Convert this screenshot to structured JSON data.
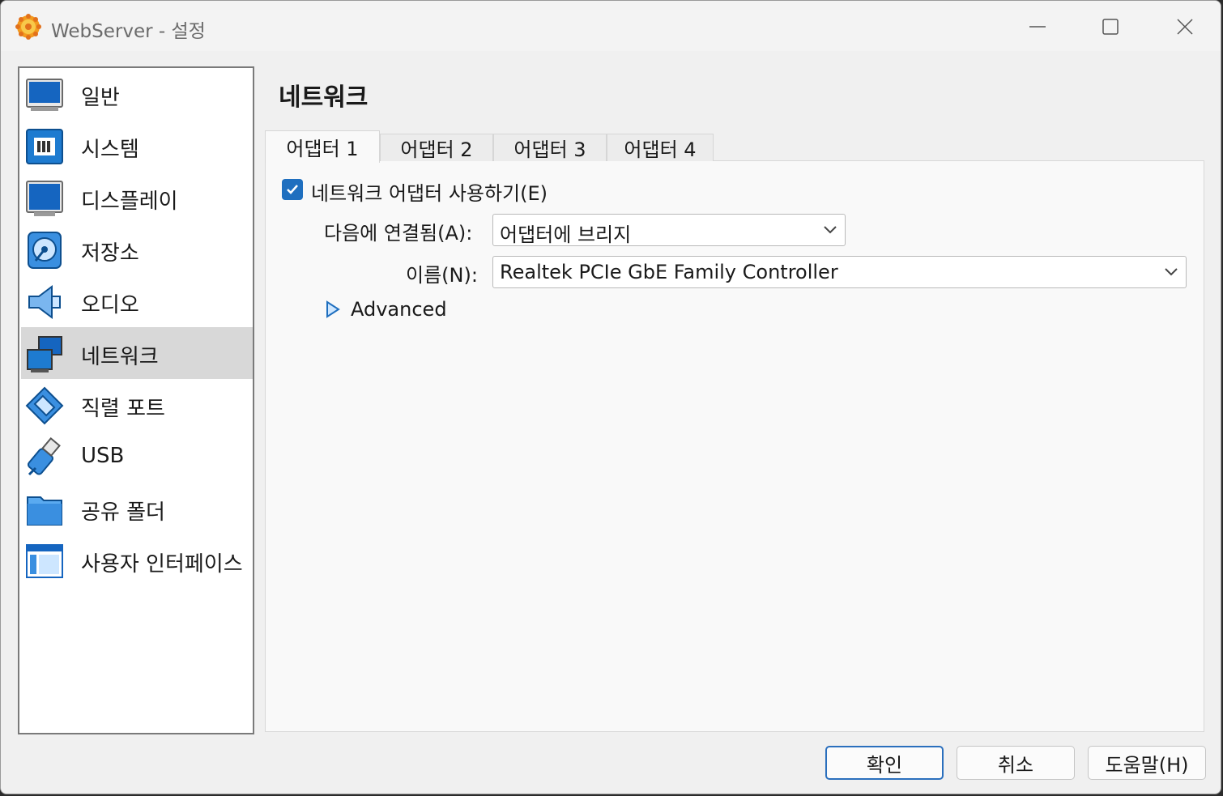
{
  "window": {
    "title": "WebServer - 설정",
    "controls": {
      "minimize": "minimize",
      "maximize": "maximize",
      "close": "close"
    }
  },
  "sidebar": {
    "items": [
      {
        "label": "일반",
        "icon": "general-icon",
        "selected": false
      },
      {
        "label": "시스템",
        "icon": "system-icon",
        "selected": false
      },
      {
        "label": "디스플레이",
        "icon": "display-icon",
        "selected": false
      },
      {
        "label": "저장소",
        "icon": "storage-icon",
        "selected": false
      },
      {
        "label": "오디오",
        "icon": "audio-icon",
        "selected": false
      },
      {
        "label": "네트워크",
        "icon": "network-icon",
        "selected": true
      },
      {
        "label": "직렬 포트",
        "icon": "serial-port-icon",
        "selected": false
      },
      {
        "label": "USB",
        "icon": "usb-icon",
        "selected": false
      },
      {
        "label": "공유 폴더",
        "icon": "shared-folder-icon",
        "selected": false
      },
      {
        "label": "사용자 인터페이스",
        "icon": "user-interface-icon",
        "selected": false
      }
    ]
  },
  "main": {
    "title": "네트워크",
    "tabs": [
      {
        "label": "어댑터 1",
        "active": true
      },
      {
        "label": "어댑터 2",
        "active": false
      },
      {
        "label": "어댑터 3",
        "active": false
      },
      {
        "label": "어댑터 4",
        "active": false
      }
    ],
    "enable_adapter": {
      "label": "네트워크 어댑터 사용하기(E)",
      "checked": true
    },
    "attached_to": {
      "label": "다음에 연결됨(A):",
      "value": "어댑터에 브리지"
    },
    "name": {
      "label": "이름(N):",
      "value": "Realtek PCIe GbE Family Controller"
    },
    "advanced": {
      "label": "Advanced",
      "expanded": false
    }
  },
  "buttons": {
    "ok": "확인",
    "cancel": "취소",
    "help": "도움말(H)"
  },
  "colors": {
    "accent": "#1f6fbf",
    "icon_blue": "#1565c0",
    "selection": "#d8d8d8"
  }
}
